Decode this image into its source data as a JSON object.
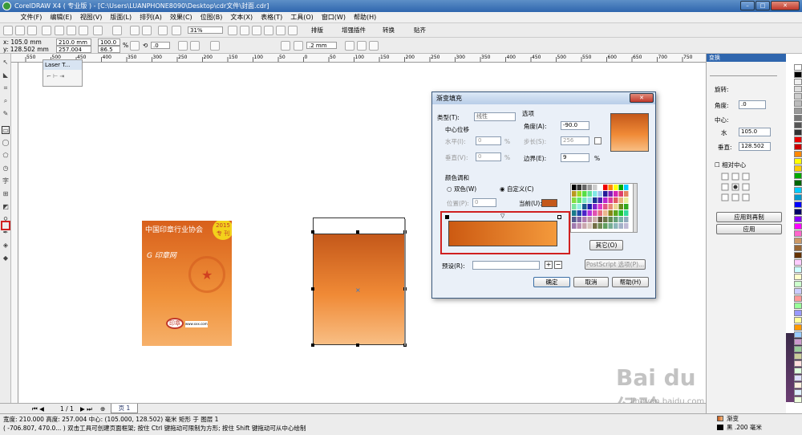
{
  "app": {
    "title": "CorelDRAW X4 ( 专业版 ) - [C:\\Users\\LUANPHONE8090\\Desktop\\cdr文件\\封面.cdr]"
  },
  "menu": [
    "文件(F)",
    "编辑(E)",
    "视图(V)",
    "版面(L)",
    "排列(A)",
    "效果(C)",
    "位图(B)",
    "文本(X)",
    "表格(T)",
    "工具(O)",
    "窗口(W)",
    "帮助(H)"
  ],
  "toolbar": {
    "zoom": "31%",
    "plugins": [
      "排版",
      "增强插件",
      "转换",
      "贴齐"
    ]
  },
  "props": {
    "x": "x: 105.0 mm",
    "y": "y: 128.502 mm",
    "w": "210.0 mm",
    "h": "257.004 mm",
    "sx": "100.0",
    "sy": "86.5",
    "pct": "%",
    "rot": ".0",
    "outline": ".2 mm"
  },
  "laser": {
    "title": "Laser T..."
  },
  "ruler": [
    "550",
    "500",
    "450",
    "400",
    "350",
    "300",
    "250",
    "200",
    "150",
    "100",
    "50",
    "0",
    "50",
    "100",
    "150",
    "200",
    "250",
    "300",
    "350",
    "400",
    "450",
    "500",
    "550",
    "600",
    "650",
    "700",
    "750"
  ],
  "cover": {
    "org": "中国印章行业协会",
    "year": "2015",
    "issue": "专 刊",
    "brand": "印章",
    "small": "www.xxx.com"
  },
  "pages": {
    "nav": "1 / 1",
    "tab": "页 1"
  },
  "status": {
    "line1": "宽度: 210.000  高度: 257.004  中心: (105.000, 128.502)  毫米       矩形 于 图层 1",
    "line2": "( -706.807, 470.0... ) 双击工具可创建页面框架; 按住 Ctrl 键拖动可限制为方形; 按住 Shift 键拖动可从中心绘制",
    "fill": "渐变",
    "outline": "黑 .200 毫米"
  },
  "docker": {
    "title": "变换",
    "rot_label": "旋转:",
    "angle_label": "角度:",
    "angle": ".0",
    "center_label": "中心:",
    "h_label": "水",
    "h_val": "105.0",
    "v_label": "垂直:",
    "v_val": "128.502",
    "relative": "相对中心",
    "apply_dup": "应用到再制",
    "apply": "应用"
  },
  "dialog": {
    "title": "渐变填充",
    "type_label": "类型(T):",
    "type_val": "线性",
    "center_offset": "中心位移",
    "horz_label": "水平(I):",
    "horz_val": "0",
    "vert_label": "垂直(V):",
    "vert_val": "0",
    "options": "选项",
    "angle_label": "角度(A):",
    "angle_val": "-90.0",
    "steps_label": "步长(S):",
    "steps_val": "256",
    "edge_label": "边界(E):",
    "edge_val": "9",
    "color_blend": "颜色调和",
    "two_color": "双色(W)",
    "custom": "自定义(C)",
    "pos_label": "位置(P):",
    "pos_val": "0",
    "current_label": "当前(U):",
    "others": "其它(O)",
    "preset_label": "预设(R):",
    "postscript": "PostScript 选项(P)...",
    "ok": "确定",
    "cancel": "取消",
    "help": "帮助(H)"
  },
  "watermark": {
    "text": "Bai du 经验",
    "url": "jingyan.baidu.com"
  },
  "colors": {
    "orange_dark": "#c4581a",
    "orange_light": "#f8be84",
    "red_box": "#d02020"
  }
}
